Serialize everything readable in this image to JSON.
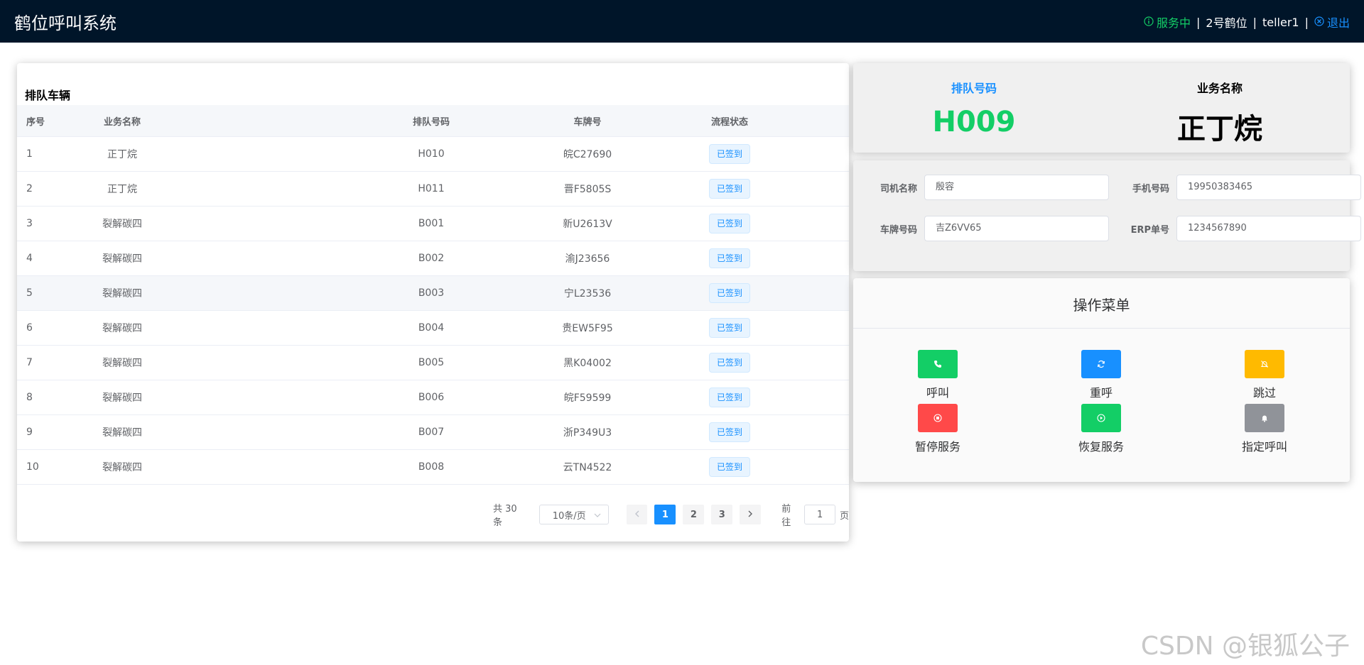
{
  "header": {
    "app_title": "鹤位呼叫系统",
    "status_text": "服务中",
    "station": "2号鹤位",
    "user": "teller1",
    "logout_label": "退出",
    "separator": "|"
  },
  "queue_panel": {
    "title": "排队车辆",
    "columns": [
      "序号",
      "业务名称",
      "排队号码",
      "车牌号",
      "流程状态"
    ],
    "rows": [
      {
        "index": "1",
        "business": "正丁烷",
        "queue_no": "H010",
        "plate": "皖C27690",
        "status": "已签到"
      },
      {
        "index": "2",
        "business": "正丁烷",
        "queue_no": "H011",
        "plate": "晋F5805S",
        "status": "已签到"
      },
      {
        "index": "3",
        "business": "裂解碳四",
        "queue_no": "B001",
        "plate": "新U2613V",
        "status": "已签到"
      },
      {
        "index": "4",
        "business": "裂解碳四",
        "queue_no": "B002",
        "plate": "渝J23656",
        "status": "已签到"
      },
      {
        "index": "5",
        "business": "裂解碳四",
        "queue_no": "B003",
        "plate": "宁L23536",
        "status": "已签到"
      },
      {
        "index": "6",
        "business": "裂解碳四",
        "queue_no": "B004",
        "plate": "贵EW5F95",
        "status": "已签到"
      },
      {
        "index": "7",
        "business": "裂解碳四",
        "queue_no": "B005",
        "plate": "黑K04002",
        "status": "已签到"
      },
      {
        "index": "8",
        "business": "裂解碳四",
        "queue_no": "B006",
        "plate": "皖F59599",
        "status": "已签到"
      },
      {
        "index": "9",
        "business": "裂解碳四",
        "queue_no": "B007",
        "plate": "浙P349U3",
        "status": "已签到"
      },
      {
        "index": "10",
        "business": "裂解碳四",
        "queue_no": "B008",
        "plate": "云TN4522",
        "status": "已签到"
      }
    ],
    "pagination": {
      "total_text": "共 30 条",
      "page_size": "10条/页",
      "pages": [
        "1",
        "2",
        "3"
      ],
      "current_page": "1",
      "goto_prefix": "前往",
      "goto_value": "1",
      "goto_suffix": "页"
    }
  },
  "current": {
    "queue_label": "排队号码",
    "queue_value": "H009",
    "business_label": "业务名称",
    "business_value": "正丁烷"
  },
  "driver_form": {
    "driver_name_label": "司机名称",
    "driver_name_value": "殷容",
    "phone_label": "手机号码",
    "phone_value": "19950383465",
    "plate_label": "车牌号码",
    "plate_value": "吉Z6VV65",
    "erp_label": "ERP单号",
    "erp_value": "1234567890"
  },
  "operations": {
    "title": "操作菜单",
    "call": "呼叫",
    "recall": "重呼",
    "skip": "跳过",
    "pause": "暂停服务",
    "resume": "恢复服务",
    "assign_call": "指定呼叫"
  },
  "watermark": "CSDN @银狐公子",
  "colors": {
    "header_bg": "#001529",
    "status_green": "#13ce66",
    "primary_blue": "#1890ff",
    "green": "#13ce66",
    "blue": "#1890ff",
    "yellow": "#ffba00",
    "red": "#ff4949",
    "grey": "#909399"
  }
}
